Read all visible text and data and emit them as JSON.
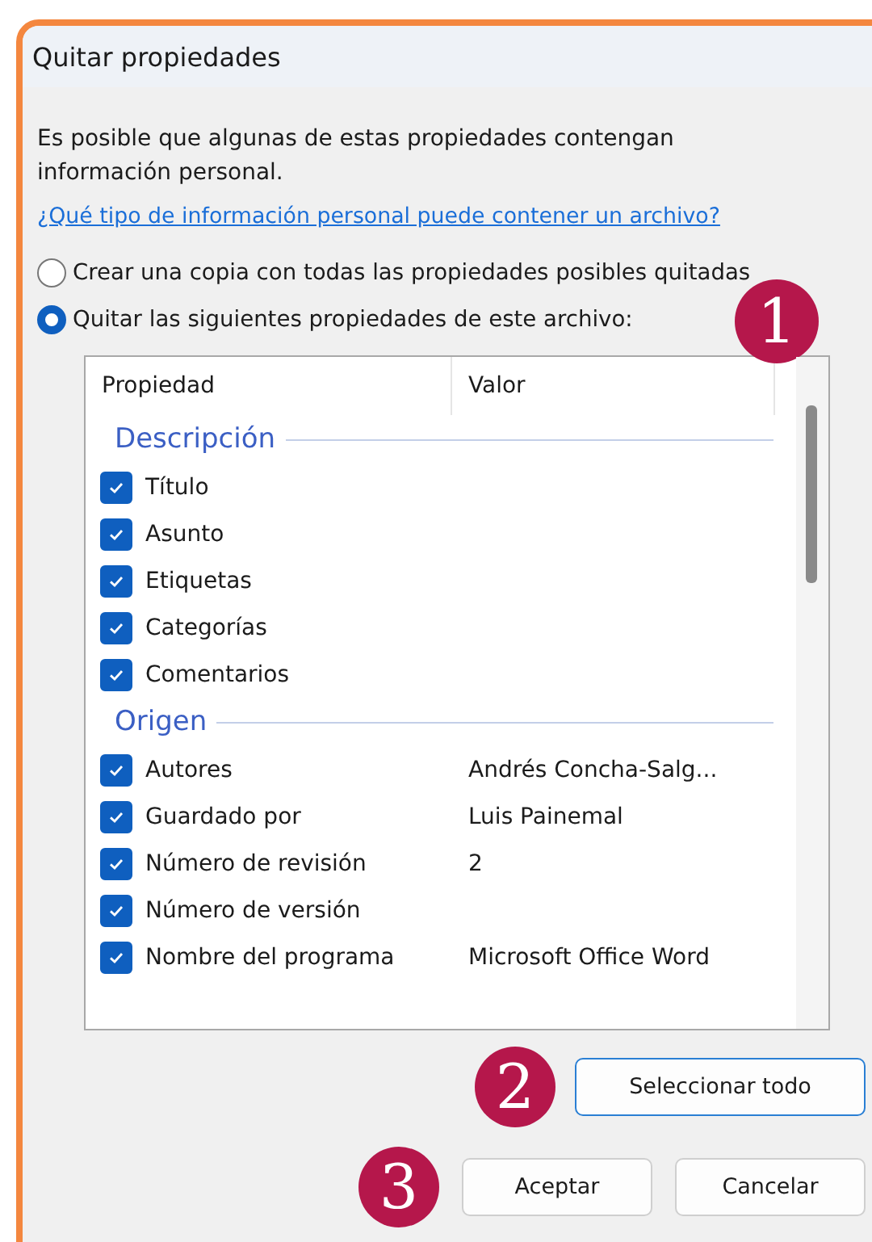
{
  "window": {
    "title": "Quitar propiedades"
  },
  "intro": "Es posible que algunas de estas propiedades contengan información personal.",
  "help_link": "¿Qué tipo de información personal puede contener un archivo?",
  "options": [
    {
      "label": "Crear una copia con todas las propiedades posibles quitadas",
      "selected": false
    },
    {
      "label": "Quitar las siguientes propiedades de este archivo:",
      "selected": true,
      "callout": "1"
    }
  ],
  "table": {
    "columns": [
      "Propiedad",
      "Valor"
    ],
    "groups": [
      {
        "name": "Descripción",
        "rows": [
          {
            "property": "Título",
            "checked": true
          },
          {
            "property": "Asunto",
            "checked": true
          },
          {
            "property": "Etiquetas",
            "checked": true
          },
          {
            "property": "Categorías",
            "checked": true
          },
          {
            "property": "Comentarios",
            "checked": true
          }
        ]
      },
      {
        "name": "Origen",
        "rows": [
          {
            "property": "Autores",
            "value": "Andrés Concha-Salg...",
            "checked": true
          },
          {
            "property": "Guardado por",
            "value": "Luis Painemal",
            "checked": true
          },
          {
            "property": "Número de revisión",
            "value": "2",
            "checked": true
          },
          {
            "property": "Número de versión",
            "checked": true
          },
          {
            "property": "Nombre del programa",
            "value": "Microsoft Office Word",
            "checked": true
          }
        ]
      }
    ]
  },
  "select_all": {
    "label": "Seleccionar todo",
    "callout": "2"
  },
  "buttons": {
    "callout": "3",
    "items": [
      "Aceptar",
      "Cancelar"
    ]
  }
}
